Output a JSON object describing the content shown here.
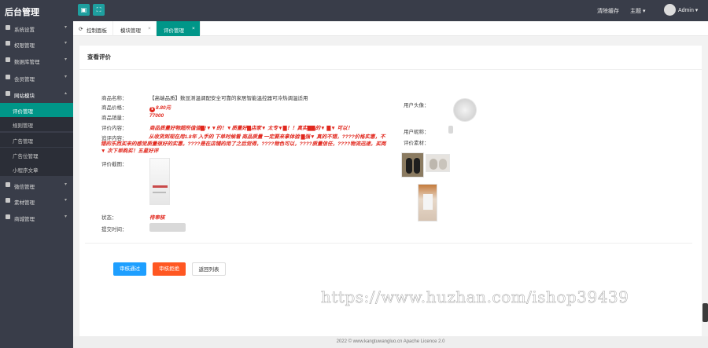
{
  "app": {
    "title": "后台管理"
  },
  "topbar": {
    "menu_items": [
      "清除缓存",
      "主题",
      "Admin"
    ],
    "right_chevrons": [
      "▾",
      "▾"
    ]
  },
  "sidebar": {
    "items": [
      {
        "label": "系统设置",
        "icon": "wrench-icon"
      },
      {
        "label": "权限管理",
        "icon": "key-icon"
      },
      {
        "label": "数据库管理",
        "icon": "database-icon"
      },
      {
        "label": "会员管理",
        "icon": "user-icon"
      },
      {
        "label": "网站模块",
        "icon": "grid-icon"
      },
      {
        "label": "微信管理",
        "icon": "wechat-icon"
      },
      {
        "label": "素材管理",
        "icon": "image-icon"
      },
      {
        "label": "商城管理",
        "icon": "shop-icon"
      }
    ],
    "sub_items": [
      "评价管理",
      "规则管理",
      "广告管理",
      "广告位管理",
      "小程序文章"
    ]
  },
  "tabs": [
    {
      "label": "控制面板"
    },
    {
      "label": "模块管理"
    },
    {
      "label": "评价管理"
    }
  ],
  "page": {
    "title": "查看评价",
    "fields": {
      "product_name_label": "商品名称：",
      "product_name": "【高端品质】数显测温调配安全可靠的家居智能温控器可冷热调温适用",
      "price_label": "商品价格：",
      "price": "8.80元",
      "sales_label": "商品销量：",
      "sales": "77000",
      "rating_label": "评价内容：",
      "rating": "商品质量好物超所值值▇!▼▼的！▼质量好▇店家▼ 太专▼▇！！真实▇▇的▼ ▇▼ 可以！",
      "review_label": "追评内容：",
      "review": "从收货到现在用1.8年 入手的 下单时候看 商品质量 一定要来拿体验 ▇强▼ 真的不错，????价格实惠，不错的东西买来的感觉质量很好的实惠，????是在店铺的用了之后觉得，????物色可以，????质量信任，????物流迅速，买两▼ 次下单购买！五星好评",
      "images_label": "评价截图：",
      "status_label": "状态：",
      "status": "待审核",
      "submit_time_label": "提交时间："
    },
    "user": {
      "avatar_label": "用户头像：",
      "nickname_label": "用户昵称：",
      "media_label": "评价素材："
    },
    "buttons": {
      "approve": "审核通过",
      "reject": "审核拒绝",
      "back": "返回列表"
    }
  },
  "watermark": "https://www.huzhan.com/ishop39439",
  "footer": "2022 © www.kangtuwangluo.cn Apache Licence 2.0",
  "colors": {
    "sidebar_bg": "#393d49",
    "accent": "#009688",
    "approve_btn": "#1e9fff",
    "reject_btn": "#ff5722",
    "emphasis_text": "#e1271d"
  }
}
